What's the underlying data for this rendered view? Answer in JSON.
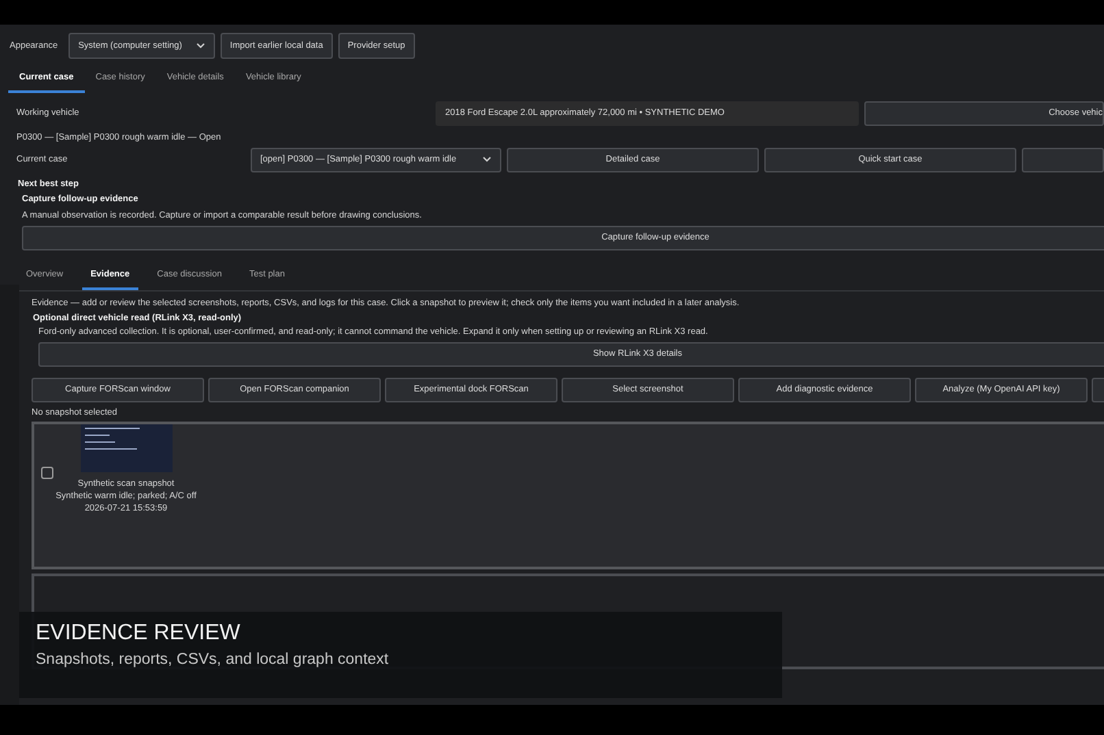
{
  "toolbar": {
    "appearance_label": "Appearance",
    "appearance_value": "System (computer setting)",
    "buttons": [
      "Import earlier local data",
      "Provider setup"
    ]
  },
  "tabs": [
    {
      "label": "Current case",
      "selected": true
    },
    {
      "label": "Case history",
      "selected": false
    },
    {
      "label": "Vehicle details",
      "selected": false
    },
    {
      "label": "Vehicle library",
      "selected": false
    }
  ],
  "working_vehicle": {
    "label": "Working vehicle",
    "value": "2018 Ford Escape 2.0L approximately 72,000 mi  • SYNTHETIC DEMO",
    "button": "Choose vehic"
  },
  "case_title": "P0300 — [Sample] P0300 rough warm idle — Open",
  "current_case": {
    "label": "Current case",
    "value": "[open] P0300 — [Sample] P0300 rough warm idle",
    "buttons": [
      "Detailed case",
      "Quick start case"
    ]
  },
  "next_step": {
    "heading": "Next best step",
    "title": "Capture follow-up evidence",
    "description": "A manual observation is recorded. Capture or import a comparable result before drawing conclusions.",
    "button": "Capture follow-up evidence"
  },
  "subtabs": [
    {
      "label": "Overview",
      "selected": false
    },
    {
      "label": "Evidence",
      "selected": true
    },
    {
      "label": "Case discussion",
      "selected": false
    },
    {
      "label": "Test plan",
      "selected": false
    }
  ],
  "evidence": {
    "intro": "Evidence — add or review the selected screenshots, reports, CSVs, and logs for this case. Click a snapshot to preview it; check only the items you want included in a later analysis.",
    "direct_read": {
      "title": "Optional direct vehicle read (RLink X3, read-only)",
      "description": "Ford-only advanced collection. It is optional, user-confirmed, and read-only; it cannot command the vehicle. Expand it only when setting up or reviewing an RLink X3 read.",
      "button": "Show RLink X3 details"
    },
    "actions": [
      "Capture FORScan window",
      "Open FORScan companion",
      "Experimental dock FORScan",
      "Select screenshot",
      "Add diagnostic evidence",
      "Analyze (My OpenAI API key)"
    ],
    "selection_status": "No snapshot selected",
    "snapshots": [
      {
        "title": "Synthetic scan snapshot",
        "caption": "Synthetic warm idle; parked; A/C off",
        "timestamp": "2026-07-21 15:53:59",
        "checked": false
      }
    ]
  },
  "caption_overlay": {
    "title": "EVIDENCE REVIEW",
    "subtitle": "Snapshots, reports, CSVs, and local graph context"
  }
}
